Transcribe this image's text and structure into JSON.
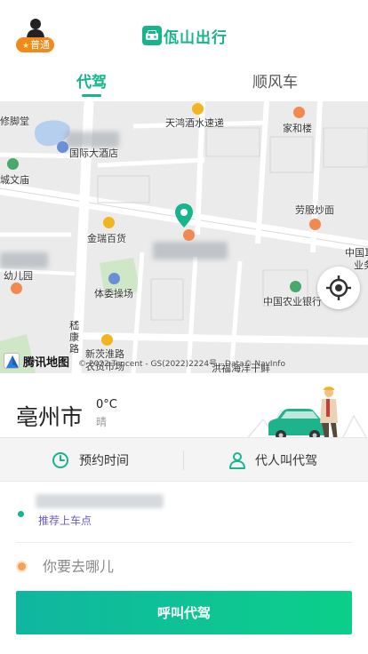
{
  "header": {
    "member_badge": "普通",
    "brand_name": "佤山出行"
  },
  "tabs": [
    {
      "label": "代驾",
      "active": true
    },
    {
      "label": "顺风车",
      "active": false
    }
  ],
  "map": {
    "labels": {
      "hall": "修脚堂",
      "express": "天鸿酒水速递",
      "jiahe": "家和楼",
      "hotel": "国际大酒店",
      "culture": "城文庙",
      "laofu": "劳服炒面",
      "jinrui": "金瑞百货",
      "bank_cut": "中国耳",
      "bank_cut2": "业务",
      "kindergarten": "幼儿园",
      "stadium": "体委操场",
      "abc": "中国农业银行",
      "road": "嵇康路",
      "market_1": "新茨淮路",
      "market_2": "农贸市场",
      "seafood": "洪福海洋干鲜"
    },
    "logo": "腾讯地图",
    "copyright": "© 2022 Tencent - GS(2022)2224号 - Data© NavInfo"
  },
  "location": {
    "city": "亳州市",
    "temperature": "0°C",
    "weather": "晴"
  },
  "options": {
    "schedule_label": "预约时间",
    "proxy_label": "代人叫代驾"
  },
  "address": {
    "pickup_hint": "推荐上车点",
    "destination_placeholder": "你要去哪儿"
  },
  "actions": {
    "call_label": "呼叫代驾"
  },
  "colors": {
    "accent": "#16b58c",
    "badge": "#f08a1c",
    "pickup_hint": "#6b5bd4",
    "destination_dot": "#f4a05a"
  }
}
